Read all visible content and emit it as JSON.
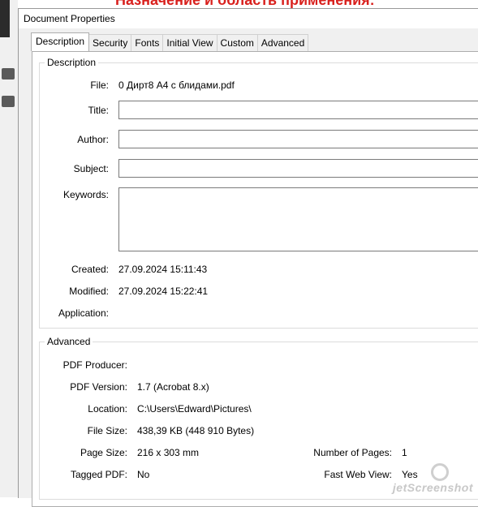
{
  "background": {
    "heading": "Назначение и область применения:"
  },
  "dialog": {
    "title": "Document Properties",
    "tabs": [
      "Description",
      "Security",
      "Fonts",
      "Initial View",
      "Custom",
      "Advanced"
    ],
    "active_tab": "Description"
  },
  "description": {
    "legend": "Description",
    "file_label": "File:",
    "file_value": "0 Дирт8 А4 с блидами.pdf",
    "title_label": "Title:",
    "title_value": "",
    "author_label": "Author:",
    "author_value": "",
    "subject_label": "Subject:",
    "subject_value": "",
    "keywords_label": "Keywords:",
    "keywords_value": "",
    "created_label": "Created:",
    "created_value": "27.09.2024 15:11:43",
    "modified_label": "Modified:",
    "modified_value": "27.09.2024 15:22:41",
    "application_label": "Application:",
    "application_value": ""
  },
  "advanced": {
    "legend": "Advanced",
    "producer_label": "PDF Producer:",
    "producer_value": "",
    "version_label": "PDF Version:",
    "version_value": "1.7 (Acrobat 8.x)",
    "location_label": "Location:",
    "location_value": "C:\\Users\\Edward\\Pictures\\",
    "filesize_label": "File Size:",
    "filesize_value": "438,39 KB (448 910 Bytes)",
    "pagesize_label": "Page Size:",
    "pagesize_value": "216 x 303 mm",
    "numpages_label": "Number of Pages:",
    "numpages_value": "1",
    "tagged_label": "Tagged PDF:",
    "tagged_value": "No",
    "fastweb_label": "Fast Web View:",
    "fastweb_value": "Yes"
  },
  "watermark": {
    "text": "jetScreenshot"
  }
}
